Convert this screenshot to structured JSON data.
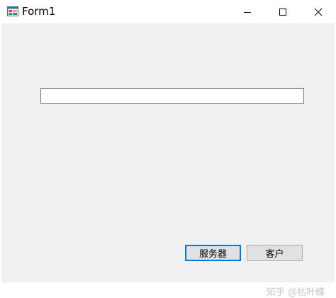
{
  "window": {
    "title": "Form1"
  },
  "titlebar": {
    "icons": [
      "app-form-icon",
      "minimize-icon",
      "maximize-icon",
      "close-icon"
    ]
  },
  "form": {
    "textbox_value": "",
    "server_button_label": "服务器",
    "client_button_label": "客户"
  },
  "watermark": {
    "text": "知乎 @枯叶蝶"
  },
  "colors": {
    "client_bg": "#f0f0f0",
    "focus_border": "#0078d7",
    "button_bg": "#e1e1e1"
  }
}
